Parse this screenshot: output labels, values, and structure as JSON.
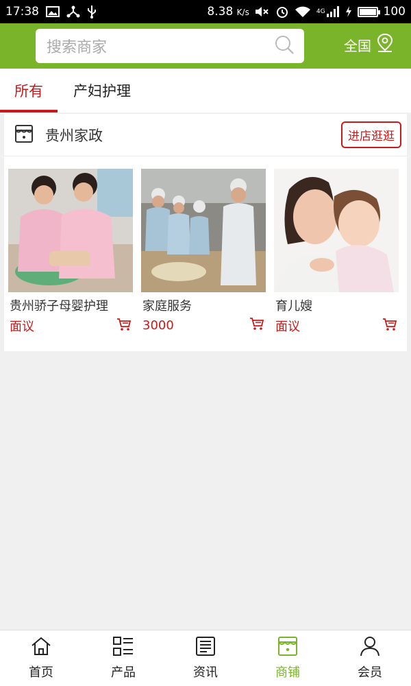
{
  "status_bar": {
    "time": "17:38",
    "speed": "8.38",
    "speed_unit": "K/s",
    "network": "4G",
    "battery": "100",
    "battery_level": 1.0
  },
  "header": {
    "search_placeholder": "搜索商家",
    "region_label": "全国"
  },
  "tabs": [
    {
      "label": "所有",
      "active": true
    },
    {
      "label": "产妇护理",
      "active": false
    }
  ],
  "shop": {
    "name": "贵州家政",
    "enter_button": "进店逛逛",
    "products": [
      {
        "name": "贵州骄子母婴护理",
        "price": "面议"
      },
      {
        "name": "家庭服务",
        "price": "3000"
      },
      {
        "name": "育儿嫂",
        "price": "面议"
      }
    ]
  },
  "bottom_nav": [
    {
      "label": "首页",
      "icon": "home-icon",
      "active": false
    },
    {
      "label": "产品",
      "icon": "product-list-icon",
      "active": false
    },
    {
      "label": "资讯",
      "icon": "news-icon",
      "active": false
    },
    {
      "label": "商铺",
      "icon": "shop-icon",
      "active": true
    },
    {
      "label": "会员",
      "icon": "member-icon",
      "active": false
    }
  ],
  "colors": {
    "brand_green": "#7ab42a",
    "accent_red": "#c81a1a"
  }
}
